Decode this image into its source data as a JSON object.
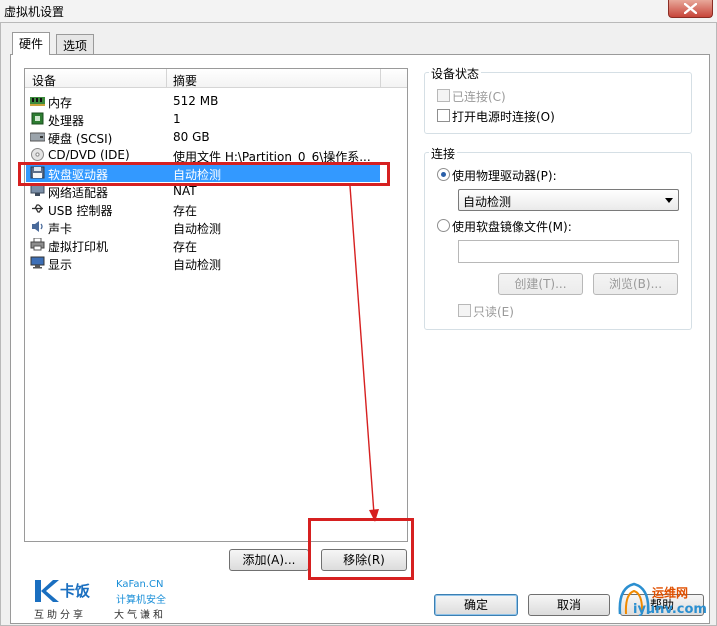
{
  "window": {
    "title": "虚拟机设置"
  },
  "tabs": [
    {
      "label": "硬件",
      "active": true
    },
    {
      "label": "选项",
      "active": false
    }
  ],
  "device_list": {
    "columns": [
      "设备",
      "摘要"
    ],
    "rows": [
      {
        "icon": "memory-icon",
        "name": "内存",
        "summary": "512 MB"
      },
      {
        "icon": "processor-icon",
        "name": "处理器",
        "summary": "1"
      },
      {
        "icon": "hard-disk-icon",
        "name": "硬盘 (SCSI)",
        "summary": "80 GB"
      },
      {
        "icon": "cd-dvd-icon",
        "name": "CD/DVD (IDE)",
        "summary": "使用文件 H:\\Partition_0_6\\操作系..."
      },
      {
        "icon": "floppy-icon",
        "name": "软盘驱动器",
        "summary": "自动检测",
        "selected": true
      },
      {
        "icon": "network-adapter-icon",
        "name": "网络适配器",
        "summary": "NAT"
      },
      {
        "icon": "usb-icon",
        "name": "USB 控制器",
        "summary": "存在"
      },
      {
        "icon": "sound-card-icon",
        "name": "声卡",
        "summary": "自动检测"
      },
      {
        "icon": "printer-icon",
        "name": "虚拟打印机",
        "summary": "存在"
      },
      {
        "icon": "display-icon",
        "name": "显示",
        "summary": "自动检测"
      }
    ]
  },
  "device_status": {
    "legend": "设备状态",
    "connected": {
      "label": "已连接(C)",
      "checked": false,
      "enabled": false
    },
    "connect_at_power_on": {
      "label": "打开电源时连接(O)",
      "checked": false,
      "enabled": true
    }
  },
  "connection": {
    "legend": "连接",
    "use_physical": {
      "label": "使用物理驱动器(P):",
      "selected": true
    },
    "physical_value": "自动检测",
    "use_image": {
      "label": "使用软盘镜像文件(M):",
      "selected": false
    },
    "image_path": "",
    "create_button": "创建(T)...",
    "browse_button": "浏览(B)...",
    "read_only": {
      "label": "只读(E)",
      "checked": false,
      "enabled": false
    }
  },
  "list_buttons": {
    "add": "添加(A)...",
    "remove": "移除(R)"
  },
  "footer_buttons": {
    "ok": "确定",
    "cancel": "取消",
    "help": "帮助"
  },
  "watermarks": {
    "kafan_cn": "卡饭",
    "kafan_domain": "KaFan.CN",
    "kafan_sub": "计算机安全",
    "kafan_slogan1": "互助分享",
    "kafan_slogan2": "大气谦和",
    "yw_text": "运维网",
    "yw_domain": "iyunv.com"
  },
  "colors": {
    "selection": "#3399ff",
    "annotation": "#d62020"
  }
}
